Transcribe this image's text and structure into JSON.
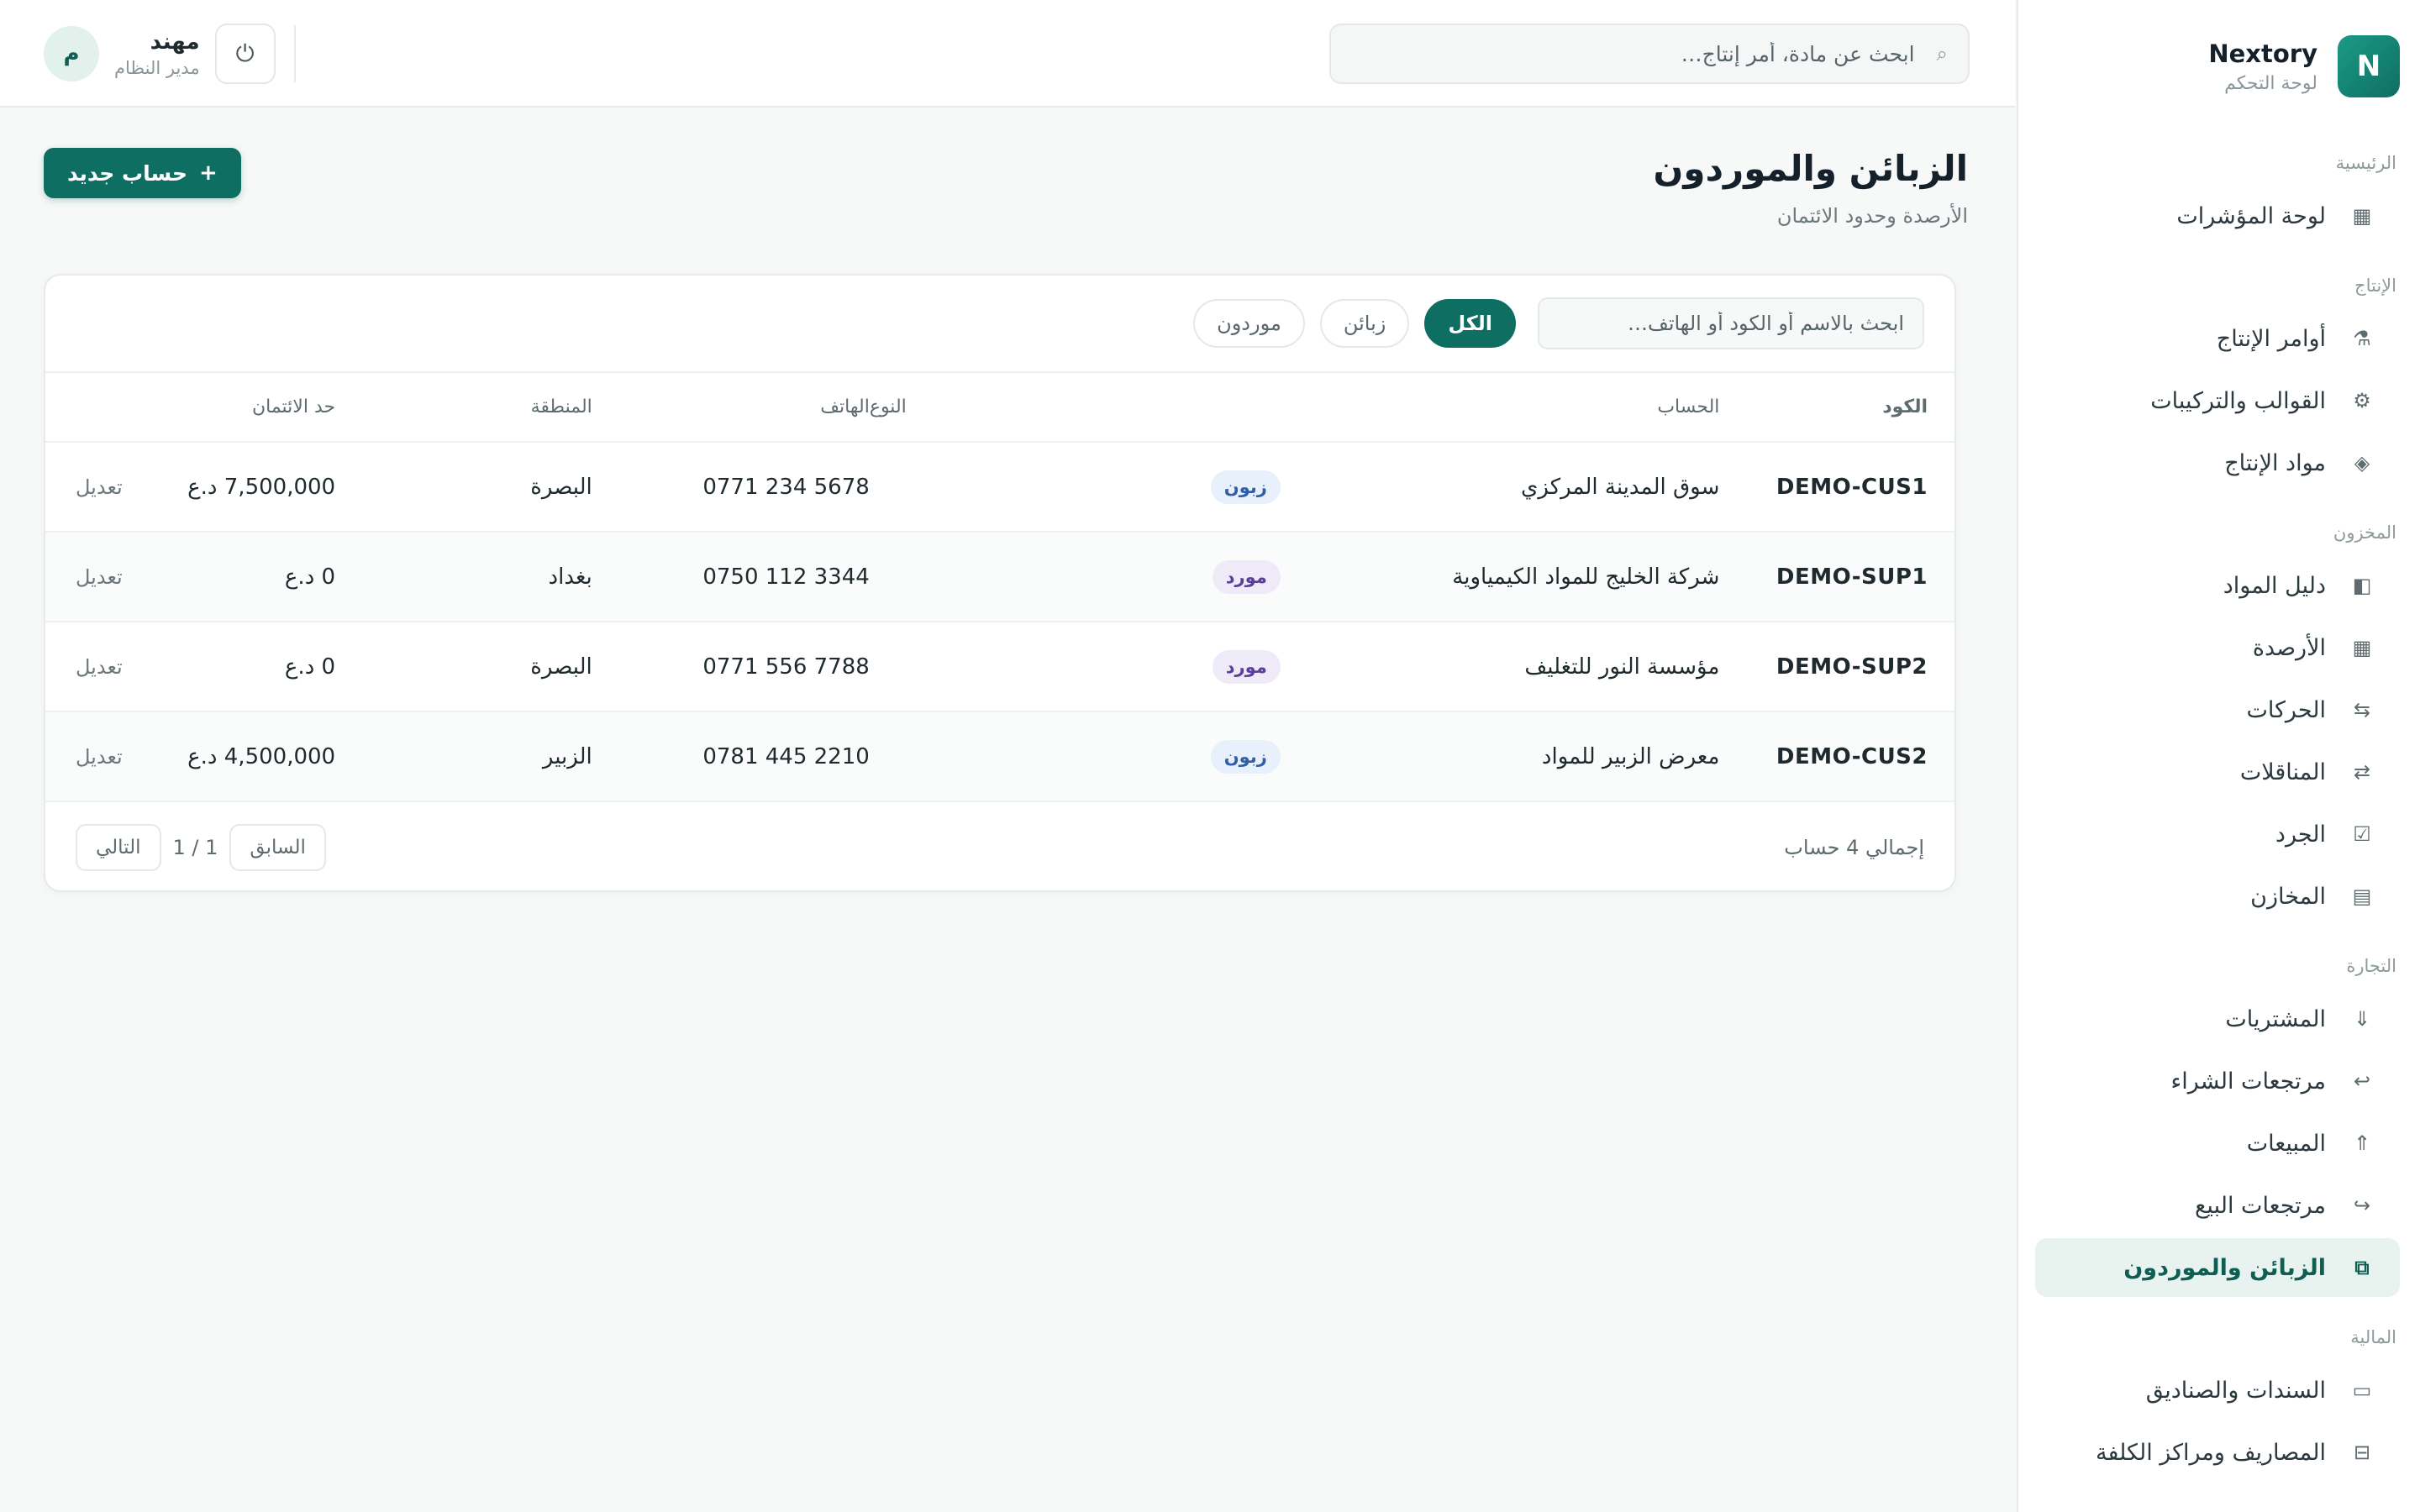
{
  "brand": {
    "logo_letter": "N",
    "name": "Nextory",
    "subtitle": "لوحة التحكم"
  },
  "sidebar": {
    "sections": [
      {
        "title": "الرئيسية",
        "items": [
          {
            "label": "لوحة المؤشرات",
            "icon": "grid-icon",
            "glyph": "▦"
          }
        ]
      },
      {
        "title": "الإنتاج",
        "items": [
          {
            "label": "أوامر الإنتاج",
            "icon": "production-icon",
            "glyph": "⚗"
          },
          {
            "label": "القوالب والتركيبات",
            "icon": "gear-icon",
            "glyph": "⚙"
          },
          {
            "label": "مواد الإنتاج",
            "icon": "diamond-icon",
            "glyph": "◈"
          }
        ]
      },
      {
        "title": "المخزون",
        "items": [
          {
            "label": "دليل المواد",
            "icon": "catalog-icon",
            "glyph": "◧"
          },
          {
            "label": "الأرصدة",
            "icon": "balances-icon",
            "glyph": "▦"
          },
          {
            "label": "الحركات",
            "icon": "movements-icon",
            "glyph": "⇆"
          },
          {
            "label": "المناقلات",
            "icon": "transfer-icon",
            "glyph": "⇄"
          },
          {
            "label": "الجرد",
            "icon": "checkbox-icon",
            "glyph": "☑"
          },
          {
            "label": "المخازن",
            "icon": "warehouse-icon",
            "glyph": "▤"
          }
        ]
      },
      {
        "title": "التجارة",
        "items": [
          {
            "label": "المشتريات",
            "icon": "arrow-down-icon",
            "glyph": "⇓"
          },
          {
            "label": "مرتجعات الشراء",
            "icon": "return-icon",
            "glyph": "↩"
          },
          {
            "label": "المبيعات",
            "icon": "arrow-up-icon",
            "glyph": "⇑"
          },
          {
            "label": "مرتجعات البيع",
            "icon": "return-right-icon",
            "glyph": "↪"
          },
          {
            "label": "الزبائن والموردون",
            "icon": "contacts-icon",
            "glyph": "⧉",
            "active": true
          }
        ]
      },
      {
        "title": "المالية",
        "items": [
          {
            "label": "السندات والصناديق",
            "icon": "cash-icon",
            "glyph": "▭"
          },
          {
            "label": "المصاريف ومراكز الكلفة",
            "icon": "expenses-icon",
            "glyph": "⊟"
          }
        ]
      }
    ]
  },
  "topbar": {
    "search_placeholder": "ابحث عن مادة، أمر إنتاج…",
    "user_name": "مهند",
    "user_role": "مدير النظام",
    "avatar_letter": "م",
    "logout_glyph": "⏻"
  },
  "page": {
    "title": "الزبائن والموردون",
    "subtitle": "الأرصدة وحدود الائتمان",
    "new_button": "حساب جديد",
    "new_button_plus": "+"
  },
  "filters": {
    "search_placeholder": "ابحث بالاسم أو الكود أو الهاتف…",
    "chips": [
      {
        "label": "الكل",
        "active": true
      },
      {
        "label": "زبائن",
        "active": false
      },
      {
        "label": "موردون",
        "active": false
      }
    ]
  },
  "table": {
    "headers": {
      "code": "الكود",
      "name": "الحساب",
      "type": "النوع",
      "phone": "الهاتف",
      "region": "المنطقة",
      "credit": "حد الائتمان"
    },
    "rows": [
      {
        "code": "DEMO-CUS1",
        "name": "سوق المدينة المركزي",
        "type": "زبون",
        "kind": "customer",
        "phone": "0771 234 5678",
        "region": "البصرة",
        "credit": "7,500,000 د.ع",
        "action": "تعديل"
      },
      {
        "code": "DEMO-SUP1",
        "name": "شركة الخليج للمواد الكيمياوية",
        "type": "مورد",
        "kind": "supplier",
        "phone": "0750 112 3344",
        "region": "بغداد",
        "credit": "0 د.ع",
        "action": "تعديل"
      },
      {
        "code": "DEMO-SUP2",
        "name": "مؤسسة النور للتغليف",
        "type": "مورد",
        "kind": "supplier",
        "phone": "0771 556 7788",
        "region": "البصرة",
        "credit": "0 د.ع",
        "action": "تعديل"
      },
      {
        "code": "DEMO-CUS2",
        "name": "معرض الزبير للمواد",
        "type": "زبون",
        "kind": "customer",
        "phone": "0781 445 2210",
        "region": "الزبير",
        "credit": "4,500,000 د.ع",
        "action": "تعديل"
      }
    ]
  },
  "footer": {
    "total": "إجمالي 4 حساب",
    "prev": "السابق",
    "page_info": "1 / 1",
    "next": "التالي"
  },
  "colors": {
    "accent": "#0f6e62",
    "accent_light": "#e8f2ef",
    "customer_badge": "#e8f0fb",
    "supplier_badge": "#efeaf8"
  }
}
